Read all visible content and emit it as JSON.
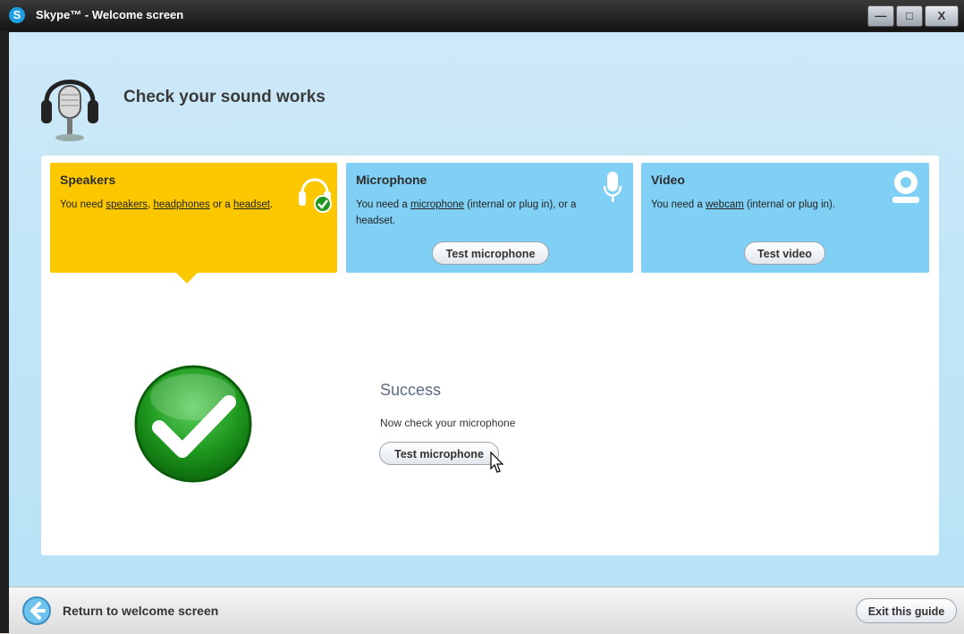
{
  "window": {
    "title": "Skype™ - Welcome screen",
    "logo": "S"
  },
  "controls": {
    "minimize": "—",
    "maximize": "□",
    "close": "X"
  },
  "header": {
    "title": "Check your sound works",
    "icon": "microphone-headset-icon"
  },
  "cards": {
    "speakers": {
      "title": "Speakers",
      "text_prefix": "You need ",
      "link1": "speakers",
      "sep1": ", ",
      "link2": "headphones",
      "sep2": " or a ",
      "link3": "headset",
      "text_suffix": ".",
      "icon": "headphones-check-icon"
    },
    "microphone": {
      "title": "Microphone",
      "text_prefix": "You need a ",
      "link": "microphone",
      "text_suffix": " (internal or plug in), or a headset.",
      "button": "Test microphone",
      "icon": "microphone-icon"
    },
    "video": {
      "title": "Video",
      "text_prefix": "You need a ",
      "link": "webcam",
      "text_suffix": " (internal or plug in).",
      "button": "Test video",
      "icon": "webcam-icon"
    }
  },
  "result": {
    "title": "Success",
    "text": "Now check your microphone",
    "button": "Test microphone"
  },
  "footer": {
    "back_label": "Return to welcome screen",
    "exit_label": "Exit this guide"
  },
  "colors": {
    "speakers_card": "#fbc800",
    "inactive_card": "#7fd0f4",
    "success_green": "#1f9a1f"
  }
}
